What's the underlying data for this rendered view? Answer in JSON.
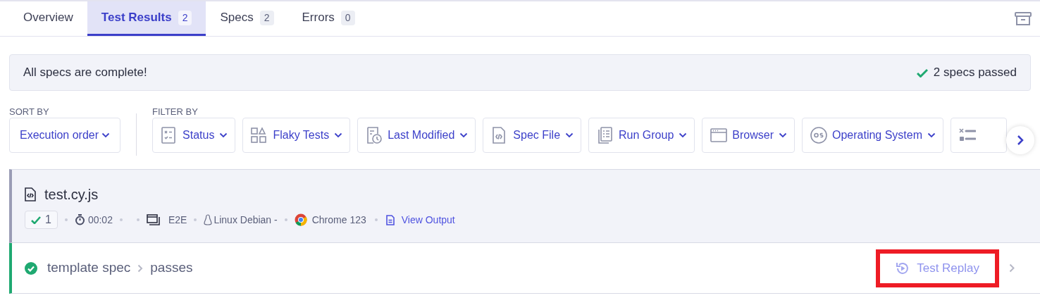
{
  "tabs": [
    {
      "label": "Overview",
      "selected": false
    },
    {
      "label": "Test Results",
      "count": "2",
      "selected": true
    },
    {
      "label": "Specs",
      "count": "2",
      "selected": false
    },
    {
      "label": "Errors",
      "count": "0",
      "selected": false
    }
  ],
  "banner": {
    "message": "All specs are complete!",
    "summary": "2 specs passed"
  },
  "sort": {
    "label": "SORT BY",
    "value": "Execution order"
  },
  "filter": {
    "label": "FILTER BY",
    "buttons": [
      {
        "kind": "status",
        "label": "Status"
      },
      {
        "kind": "flaky",
        "label": "Flaky Tests"
      },
      {
        "kind": "modified",
        "label": "Last Modified"
      },
      {
        "kind": "spec",
        "label": "Spec File"
      },
      {
        "kind": "group",
        "label": "Run Group"
      },
      {
        "kind": "browser",
        "label": "Browser"
      },
      {
        "kind": "os",
        "label": "Operating System"
      },
      {
        "kind": "list"
      }
    ]
  },
  "spec": {
    "file": "test.cy.js",
    "passed": "1",
    "duration": "00:02",
    "testing_type": "E2E",
    "os": "Linux Debian -",
    "browser": "Chrome 123",
    "output_link": "View Output"
  },
  "test": {
    "passed": true,
    "path": [
      "template spec",
      "passes"
    ],
    "replay": "Test Replay",
    "highlighted": true
  }
}
